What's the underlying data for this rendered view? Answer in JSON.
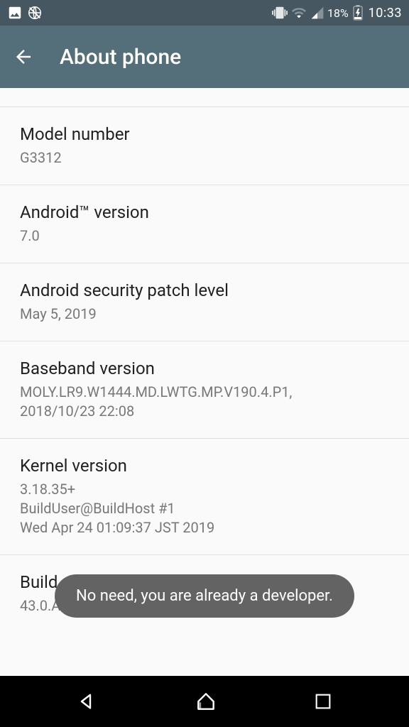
{
  "status": {
    "battery_percent": "18%",
    "time": "10:33"
  },
  "header": {
    "title": "About phone"
  },
  "items": [
    {
      "label": "Model number",
      "value": "G3312"
    },
    {
      "label": "Android™ version",
      "value": "7.0"
    },
    {
      "label": "Android security patch level",
      "value": "May 5, 2019"
    },
    {
      "label": "Baseband version",
      "value": "MOLY.LR9.W1444.MD.LWTG.MP.V190.4.P1,\n2018/10/23 22:08"
    },
    {
      "label": "Kernel version",
      "value": "3.18.35+\nBuildUser@BuildHost #1\nWed Apr 24 01:09:37 JST 2019"
    },
    {
      "label": "Build number",
      "value": "43.0.A.7.106"
    }
  ],
  "toast": "No need, you are already a developer."
}
